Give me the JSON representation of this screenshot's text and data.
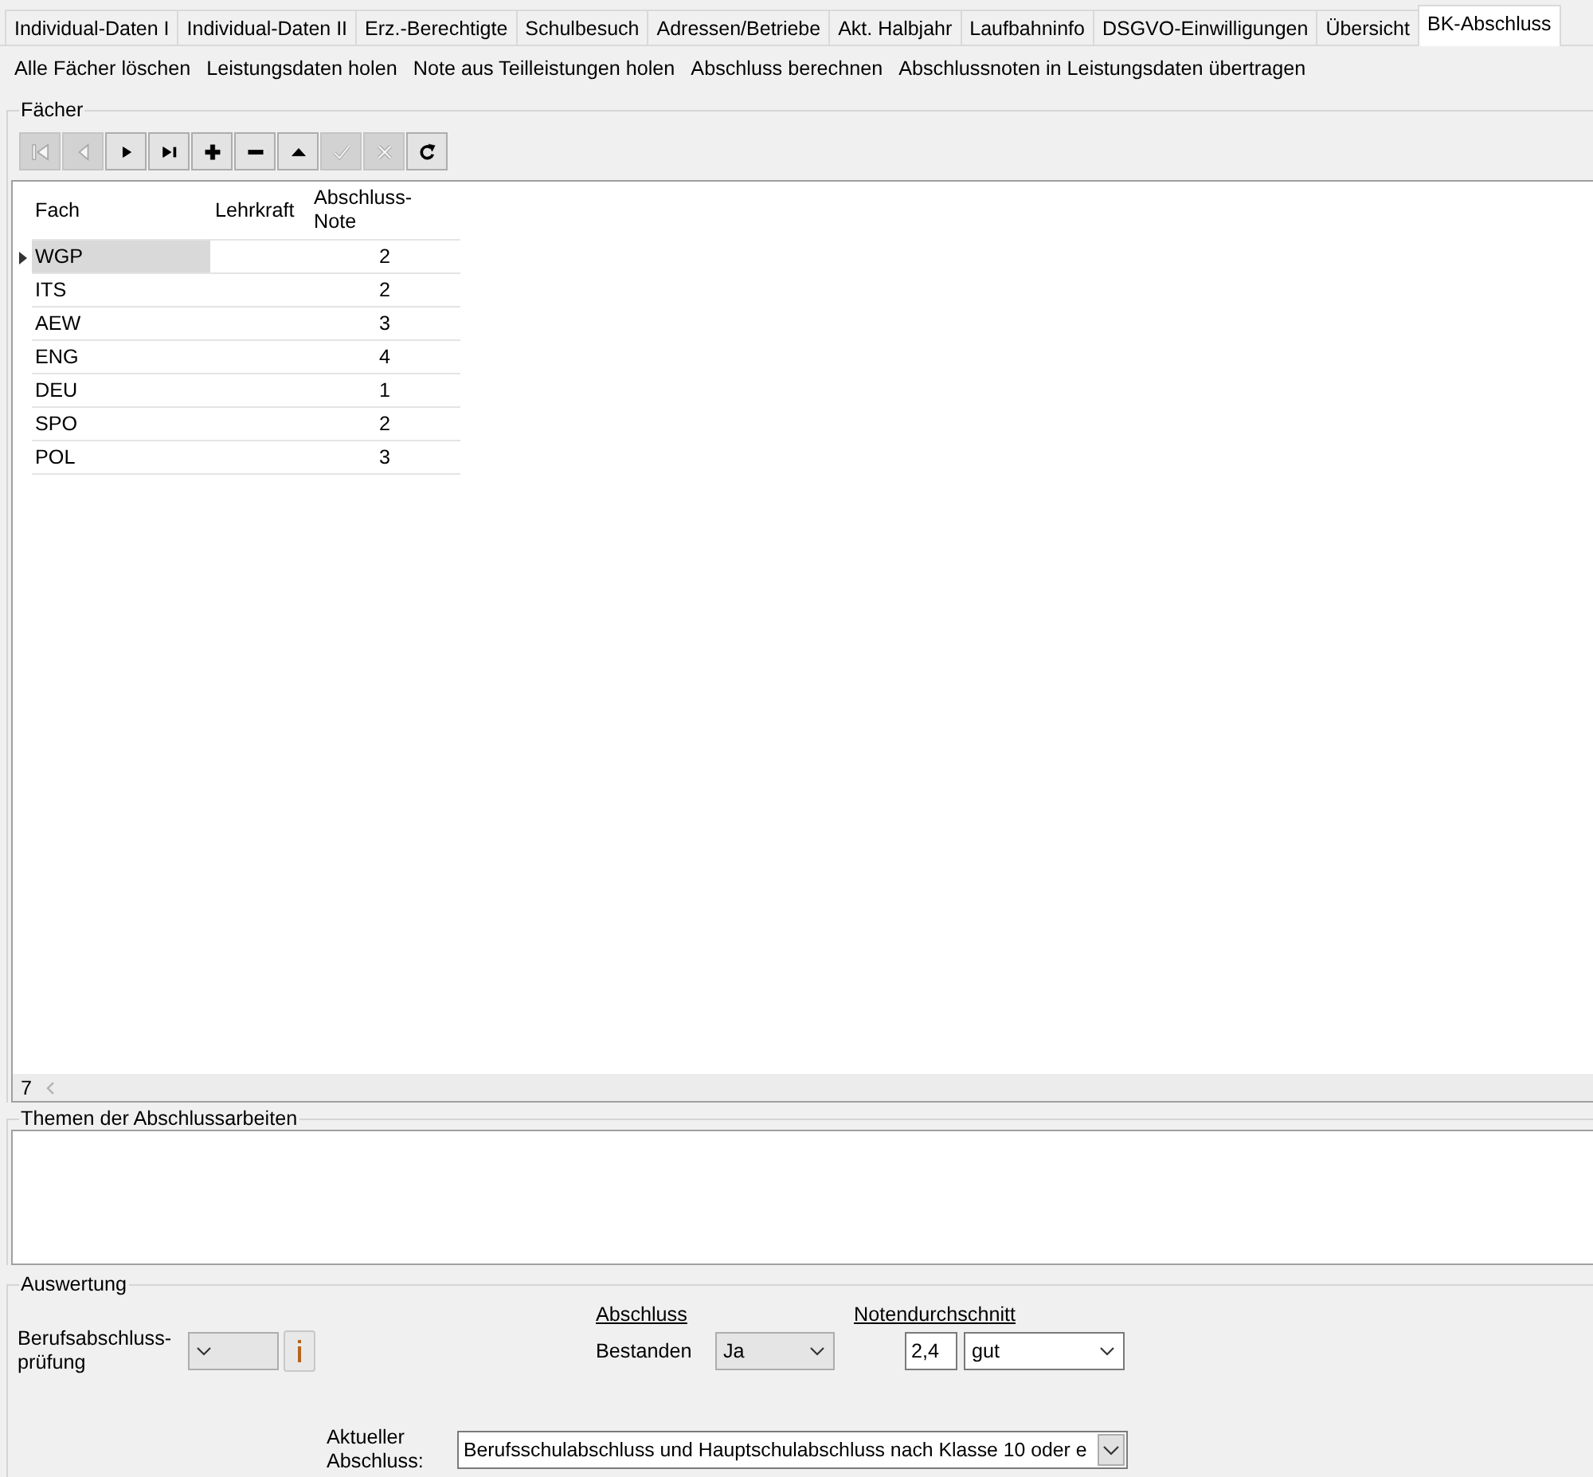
{
  "tabs": [
    {
      "label": "Individual-Daten I",
      "selected": false
    },
    {
      "label": "Individual-Daten II",
      "selected": false
    },
    {
      "label": "Erz.-Berechtigte",
      "selected": false
    },
    {
      "label": "Schulbesuch",
      "selected": false
    },
    {
      "label": "Adressen/Betriebe",
      "selected": false
    },
    {
      "label": "Akt. Halbjahr",
      "selected": false
    },
    {
      "label": "Laufbahninfo",
      "selected": false
    },
    {
      "label": "DSGVO-Einwilligungen",
      "selected": false
    },
    {
      "label": "Übersicht",
      "selected": false
    },
    {
      "label": "BK-Abschluss",
      "selected": true
    }
  ],
  "actions": [
    "Alle Fächer löschen",
    "Leistungsdaten holen",
    "Note aus Teilleistungen holen",
    "Abschluss berechnen",
    "Abschlussnoten in Leistungsdaten übertragen"
  ],
  "faecher": {
    "title": "Fächer",
    "toolbar": [
      {
        "kind": "first",
        "disabled": true
      },
      {
        "kind": "prior",
        "disabled": true
      },
      {
        "kind": "next",
        "disabled": false
      },
      {
        "kind": "last",
        "disabled": false
      },
      {
        "kind": "insert",
        "disabled": false
      },
      {
        "kind": "delete",
        "disabled": false
      },
      {
        "kind": "edit",
        "disabled": false
      },
      {
        "kind": "post",
        "disabled": true
      },
      {
        "kind": "cancel",
        "disabled": true
      },
      {
        "kind": "refresh",
        "disabled": false
      }
    ],
    "columns": [
      "Fach",
      "Lehrkraft",
      "Abschluss-\nNote"
    ],
    "rows": [
      {
        "fach": "WGP",
        "note": "2",
        "selected": true
      },
      {
        "fach": "ITS",
        "note": "2",
        "selected": false
      },
      {
        "fach": "AEW",
        "note": "3",
        "selected": false
      },
      {
        "fach": "ENG",
        "note": "4",
        "selected": false
      },
      {
        "fach": "DEU",
        "note": "1",
        "selected": false
      },
      {
        "fach": "SPO",
        "note": "2",
        "selected": false
      },
      {
        "fach": "POL",
        "note": "3",
        "selected": false
      }
    ],
    "record_count": "7"
  },
  "themen": {
    "title": "Themen der Abschlussarbeiten"
  },
  "auswertung": {
    "title": "Auswertung",
    "pruefung": {
      "label": "Berufsabschluss-\nprüfung",
      "disabled": true
    },
    "abschluss": {
      "heading": "Abschluss",
      "label": "Bestanden",
      "value": "Ja",
      "disabled": true
    },
    "notendurchschnitt": {
      "heading": "Notendurchschnitt",
      "value": "2,4",
      "grade": "gut",
      "disabled": false
    },
    "aktueller_abschluss": {
      "label": "Aktueller\nAbschluss:",
      "value": "Berufsschulabschluss und Hauptschulabschluss nach Klasse 10 oder e",
      "disabled": false
    }
  }
}
